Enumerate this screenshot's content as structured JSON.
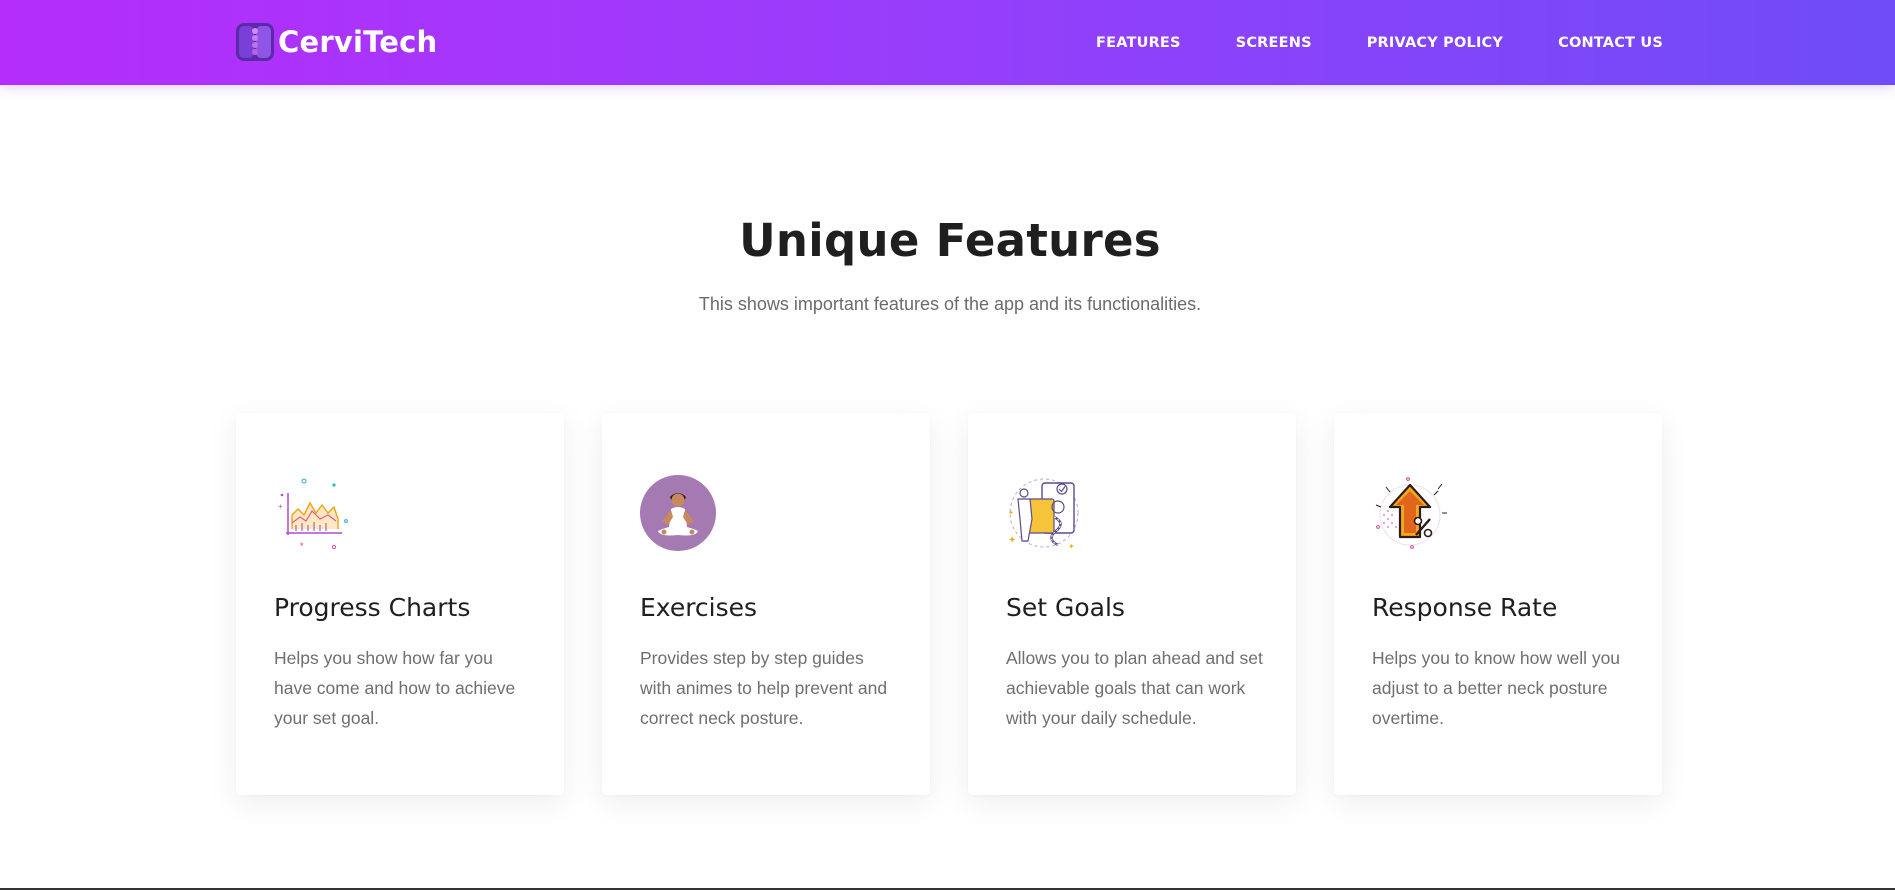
{
  "brand": {
    "name": "CerviTech"
  },
  "nav": {
    "items": [
      {
        "label": "FEATURES"
      },
      {
        "label": "SCREENS"
      },
      {
        "label": "PRIVACY POLICY"
      },
      {
        "label": "CONTACT US"
      }
    ]
  },
  "features": {
    "title": "Unique Features",
    "subtitle": "This shows important features of the app and its functionalities.",
    "cards": [
      {
        "icon": "progress-chart-icon",
        "title": "Progress Charts",
        "text": "Helps you show how far you have come and how to achieve your set goal."
      },
      {
        "icon": "meditation-icon",
        "title": "Exercises",
        "text": "Provides step by step guides with animes to help prevent and correct neck posture."
      },
      {
        "icon": "goals-icon",
        "title": "Set Goals",
        "text": "Allows you to plan ahead and set achievable goals that can work with your daily schedule."
      },
      {
        "icon": "growth-arrow-icon",
        "title": "Response Rate",
        "text": "Helps you to know how well you adjust to a better neck posture overtime."
      }
    ]
  },
  "colors": {
    "nav_gradient_start": "#b52dfb",
    "nav_gradient_end": "#6f4cf8",
    "exercise_circle": "#a57ab2"
  }
}
